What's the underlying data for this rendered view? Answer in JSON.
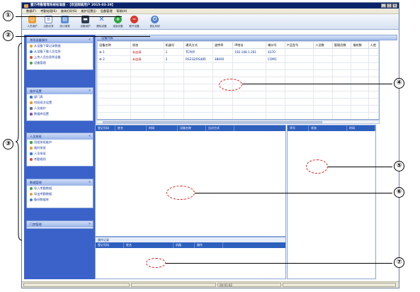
{
  "window": {
    "title": "壹力考勤管理系统标准版 -【欢迎超级用户 2015-03-29】",
    "controls": [
      "_",
      "□",
      "×"
    ]
  },
  "menu": [
    "数据(F)",
    "考勤处理(K)",
    "查询打印(S)",
    "维护设置(J)",
    "设备管理",
    "帮助(H)"
  ],
  "toolbar": [
    {
      "label": "人员维护",
      "icon": "people-icon",
      "color": "#e9a23b"
    },
    {
      "label": "出勤记录",
      "icon": "document-icon",
      "color": "#6a88c9"
    },
    {
      "label": "统计报表",
      "icon": "report-icon",
      "color": "#5b8fd6"
    },
    {
      "label": "设备维护",
      "icon": "monitor-icon",
      "color": "#2f3c55"
    },
    {
      "label": "删除设备",
      "icon": "delete-icon",
      "color": "#3a7ad8"
    },
    {
      "label": "连接设备",
      "icon": "connect-icon",
      "color": "#2fa844"
    },
    {
      "label": "断开设备",
      "icon": "disconnect-icon",
      "color": "#d83a2a"
    },
    {
      "label": "退出系统",
      "icon": "exit-icon",
      "color": "#4f7fcf"
    }
  ],
  "sidebar": {
    "panels": [
      {
        "title": "常用设备操作",
        "items": [
          "从设备下载记录数据",
          "从设备下载人员信息",
          "上传人员信息到设备",
          "设备管理"
        ]
      },
      {
        "title": "维护设置",
        "items": [
          "部门表",
          "时段班次设置",
          "人员维护",
          "数据库设置"
        ]
      },
      {
        "title": "人员排班",
        "items": [
          "班组排班维护",
          "临时排班",
          "人员排班",
          "考勤规则"
        ]
      },
      {
        "title": "数据管理",
        "items": [
          "导入考勤数据",
          "导出考勤数据",
          "备份数据库"
        ]
      },
      {
        "title": "门禁管理",
        "items": []
      }
    ]
  },
  "device_list": {
    "caption": "设备列表",
    "columns": [
      "设备名称",
      "状态",
      "机器号",
      "通讯方式",
      "波特率",
      "IP地址",
      "端口号",
      "产品型号",
      "人员数",
      "管理员数",
      "指纹数",
      "人脸"
    ],
    "rows": [
      {
        "name": "1",
        "status": "未连接",
        "machine": "1",
        "comm": "TCP/IP",
        "baud": "",
        "ip": "192.168.1.201",
        "port": "4370"
      },
      {
        "name": "2",
        "status": "未连接",
        "machine": "2",
        "comm": "RS232/RS485",
        "baud": "38400",
        "ip": "",
        "port": "COM1"
      }
    ]
  },
  "records": {
    "columns": [
      "登记号码",
      "姓名",
      "时间",
      "设备名称",
      "比对方式"
    ]
  },
  "right_panel": {
    "columns": [
      "序号",
      "状态",
      "时间"
    ]
  },
  "log": {
    "caption": "操作记录",
    "columns": [
      "登记号码",
      "姓名",
      "机器",
      "操作"
    ]
  },
  "status": {
    "time": "00:01:02"
  },
  "callouts": [
    "①",
    "②",
    "③",
    "④",
    "⑤",
    "⑥",
    "⑦"
  ]
}
